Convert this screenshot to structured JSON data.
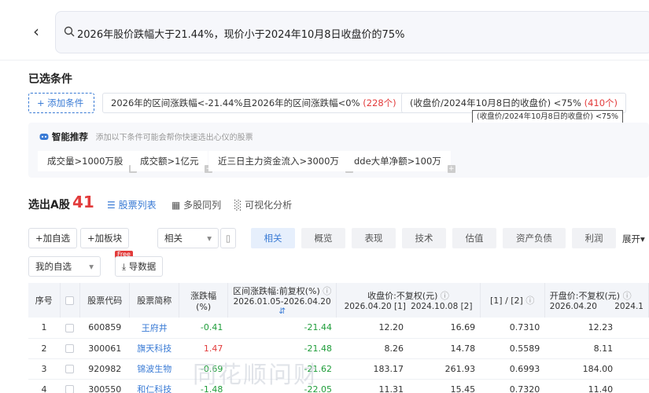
{
  "search": {
    "query": "2026年股价跌幅大于21.44%，现价小于2024年10月8日收盘价的75%"
  },
  "selected": {
    "title": "已选条件",
    "add_label": "添加条件",
    "cond1_text": "2026年的区间涨跌幅<-21.44%且2026年的区间涨跌幅<0%",
    "cond1_count": "(228个)",
    "cond2_text": "(收盘价/2024年10月8日的收盘价) <75%",
    "cond2_count": "(410个)",
    "tooltip": "(收盘价/2024年10月8日的收盘价) <75%"
  },
  "smart": {
    "title": "智能推荐",
    "hint": "添加以下条件可能会帮你快速选出心仪的股票",
    "items": [
      "成交量>1000万股",
      "成交额>1亿元",
      "近三日主力资金流入>3000万",
      "dde大单净额>100万"
    ]
  },
  "results": {
    "title": "选出A股",
    "count": "41",
    "view_tabs": [
      "股票列表",
      "多股同列",
      "可视化分析"
    ]
  },
  "toolbar": {
    "add_watch": "加自选",
    "add_sector": "加板块",
    "related": "相关",
    "watchlist": "我的自选",
    "export": "导数据",
    "free_badge": "Free",
    "more": "展开"
  },
  "categories": [
    "相关",
    "概览",
    "表现",
    "技术",
    "估值",
    "资产负债",
    "利润"
  ],
  "table": {
    "headers": {
      "idx": "序号",
      "code": "股票代码",
      "name": "股票简称",
      "chg": "涨跌幅(%)",
      "range_title": "区间涨跌幅:前复权(%)",
      "range_sub": "2026.01.05-2026.04.20",
      "close_title": "收盘价:不复权(元)",
      "close_sub1": "2026.04.20 [1]",
      "close_sub2": "2024.10.08 [2]",
      "ratio": "[1] / [2]",
      "open_title": "开盘价:不复权(元)",
      "open_sub1": "2026.04.20",
      "open_sub2": "2024.1"
    },
    "rows": [
      {
        "idx": "1",
        "code": "600859",
        "name": "王府井",
        "chg": "-0.41",
        "range": "-21.44",
        "c1": "12.20",
        "c2": "16.69",
        "ratio": "0.7310",
        "open": "12.23"
      },
      {
        "idx": "2",
        "code": "300061",
        "name": "旗天科技",
        "chg": "1.47",
        "range": "-21.48",
        "c1": "8.26",
        "c2": "14.78",
        "ratio": "0.5589",
        "open": "8.11"
      },
      {
        "idx": "3",
        "code": "920982",
        "name": "锦波生物",
        "chg": "-0.69",
        "range": "-21.62",
        "c1": "183.17",
        "c2": "261.93",
        "ratio": "0.6993",
        "open": "184.00"
      },
      {
        "idx": "4",
        "code": "300550",
        "name": "和仁科技",
        "chg": "-1.48",
        "range": "-22.05",
        "c1": "11.31",
        "c2": "15.45",
        "ratio": "0.7320",
        "open": "11.40"
      }
    ]
  },
  "watermark": "同花顺问财",
  "colors": {
    "accent": "#3a7bd5",
    "up": "#e23b3b",
    "down": "#1f9d3a"
  }
}
